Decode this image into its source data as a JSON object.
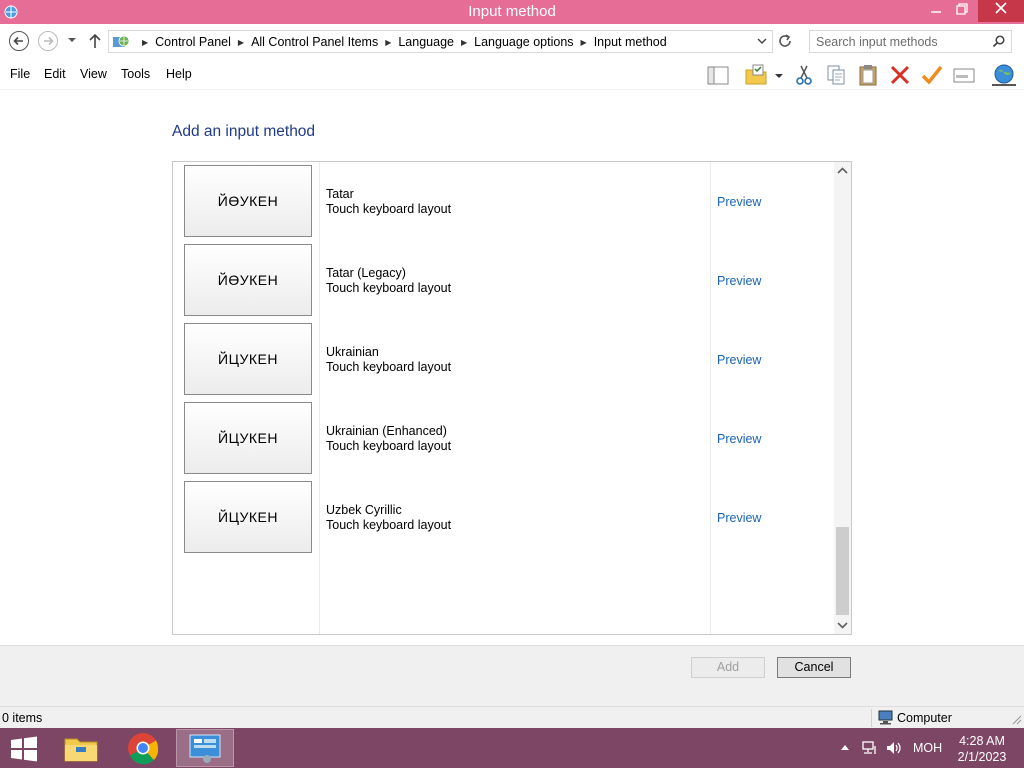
{
  "window": {
    "title": "Input method"
  },
  "address": {
    "crumbs": [
      "Control Panel",
      "All Control Panel Items",
      "Language",
      "Language options",
      "Input method"
    ],
    "search_placeholder": "Search input methods"
  },
  "menu": {
    "items": [
      "File",
      "Edit",
      "View",
      "Tools",
      "Help"
    ]
  },
  "main": {
    "heading": "Add an input method",
    "rows": [
      {
        "keyboard": "ЙӨУКЕН",
        "name": "Tatar",
        "description": "Touch keyboard layout",
        "link": "Preview"
      },
      {
        "keyboard": "ЙӨУКЕН",
        "name": "Tatar (Legacy)",
        "description": "Touch keyboard layout",
        "link": "Preview"
      },
      {
        "keyboard": "ЙЦУКЕН",
        "name": "Ukrainian",
        "description": "Touch keyboard layout",
        "link": "Preview"
      },
      {
        "keyboard": "ЙЦУКЕН",
        "name": "Ukrainian (Enhanced)",
        "description": "Touch keyboard layout",
        "link": "Preview"
      },
      {
        "keyboard": "ЙЦУКЕН",
        "name": "Uzbek Cyrillic",
        "description": "Touch keyboard layout",
        "link": "Preview"
      }
    ]
  },
  "buttons": {
    "add": "Add",
    "cancel": "Cancel"
  },
  "status": {
    "items": "0 items",
    "zone": "Computer"
  },
  "taskbar": {
    "language": "МОН",
    "time": "4:28 AM",
    "date": "2/1/2023"
  },
  "colors": {
    "titlebar": "#e66e96",
    "close": "#c7374a",
    "taskbar": "#7d4664",
    "link": "#1a64b4",
    "heading": "#1f3a8a"
  }
}
